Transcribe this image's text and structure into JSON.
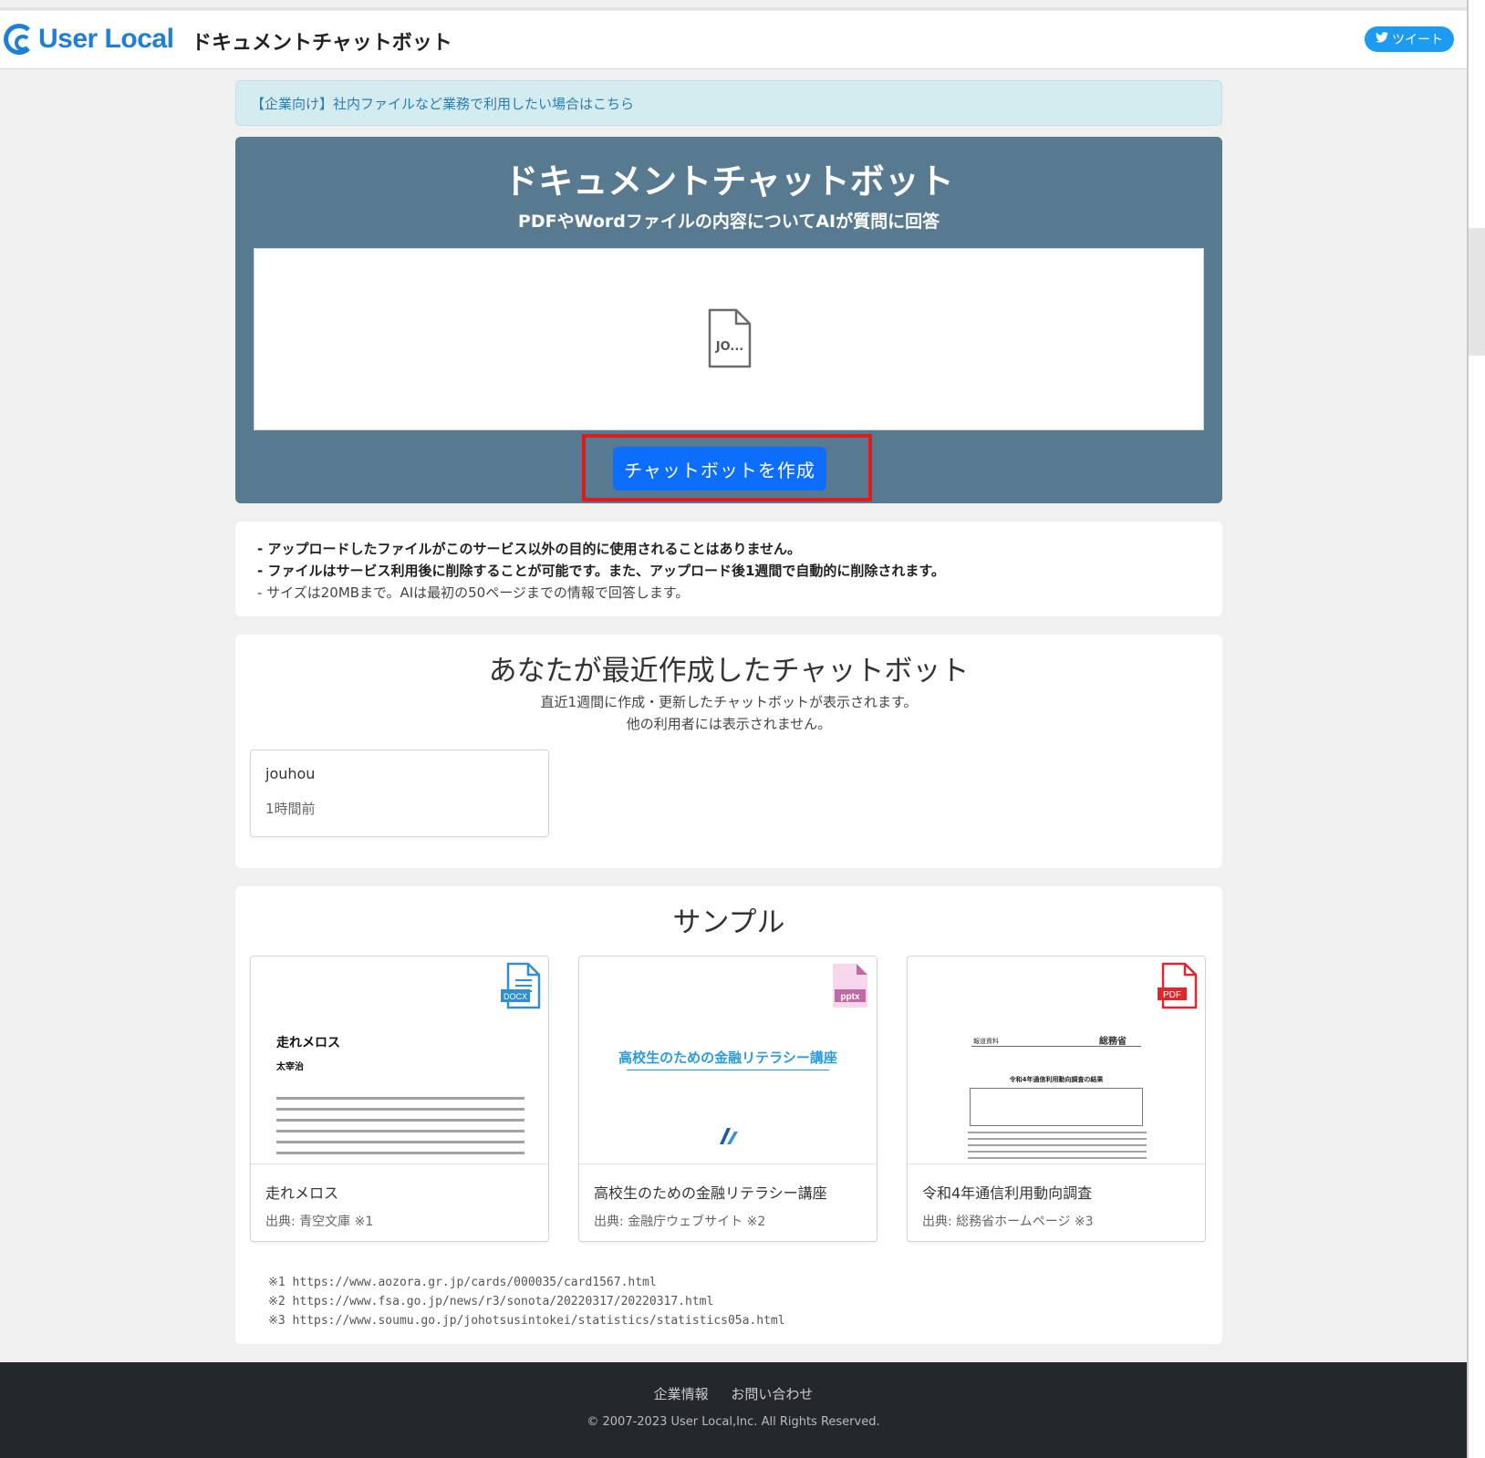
{
  "header": {
    "logo_text": "User Local",
    "site_title": "ドキュメントチャットボット",
    "tweet_label": "ツイート"
  },
  "banner": {
    "text": "【企業向け】社内ファイルなど業務で利用したい場合はこちら"
  },
  "hero": {
    "title": "ドキュメントチャットボット",
    "subtitle": "PDFやWordファイルの内容についてAIが質問に回答",
    "file_label": "JO...",
    "create_button": "チャットボットを作成"
  },
  "notes": {
    "line1": "- アップロードしたファイルがこのサービス以外の目的に使用されることはありません。",
    "line2": "- ファイルはサービス利用後に削除することが可能です。また、アップロード後1週間で自動的に削除されます。",
    "line3": "- サイズは20MBまで。AIは最初の50ページまでの情報で回答します。"
  },
  "recent": {
    "title": "あなたが最近作成したチャットボット",
    "desc1": "直近1週間に作成・更新したチャットボットが表示されます。",
    "desc2": "他の利用者には表示されません。",
    "items": [
      {
        "name": "jouhou",
        "time": "1時間前"
      }
    ]
  },
  "samples": {
    "title": "サンプル",
    "items": [
      {
        "name": "走れメロス",
        "source": "出典: 青空文庫 ※1",
        "badge": "DOCX",
        "thumb_title": "走れメロス",
        "thumb_author": "太宰治"
      },
      {
        "name": "高校生のための金融リテラシー講座",
        "source": "出典: 金融庁ウェブサイト ※2",
        "badge": "pptx",
        "thumb_title": "高校生のための金融リテラシー講座"
      },
      {
        "name": "令和4年通信利用動向調査",
        "source": "出典: 総務省ホームページ ※3",
        "badge": "PDF",
        "thumb_title": "令和4年通信利用動向調査の結果",
        "thumb_org": "総務省",
        "thumb_label": "報道資料"
      }
    ],
    "footnotes": [
      "※1 https://www.aozora.gr.jp/cards/000035/card1567.html",
      "※2 https://www.fsa.go.jp/news/r3/sonota/20220317/20220317.html",
      "※3 https://www.soumu.go.jp/johotsusintokei/statistics/statistics05a.html"
    ]
  },
  "footer": {
    "company_link": "企業情報",
    "contact_link": "お問い合わせ",
    "copyright": "© 2007-2023 User Local,Inc. All Rights Reserved."
  },
  "colors": {
    "brand": "#1d7fd6",
    "hero_bg": "#577a90",
    "primary_button": "#0d6efd",
    "highlight_border": "#e01b1b",
    "footer_bg": "#24282d"
  }
}
